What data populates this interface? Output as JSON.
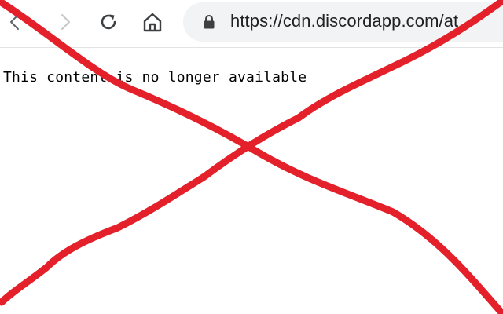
{
  "browser": {
    "back_icon": "chevron-left-icon",
    "forward_icon": "chevron-right-icon",
    "reload_icon": "reload-icon",
    "home_icon": "home-icon",
    "lock_icon": "lock-icon",
    "url": "https://cdn.discordapp.com/at"
  },
  "content": {
    "message": "This content is no longer available"
  },
  "overlay": {
    "color": "#e4202a"
  }
}
